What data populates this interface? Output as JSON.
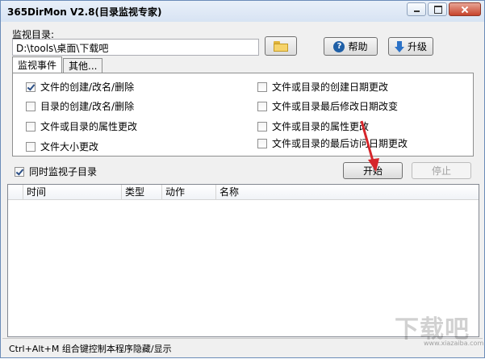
{
  "window": {
    "title": "365DirMon V2.8(目录监视专家)"
  },
  "folder": {
    "label": "监视目录:",
    "path": "D:\\tools\\桌面\\下载吧"
  },
  "buttons": {
    "help": "帮助",
    "upgrade": "升级",
    "start": "开始",
    "stop": "停止"
  },
  "tabs": [
    {
      "label": "监视事件"
    },
    {
      "label": "其他..."
    }
  ],
  "events_left": [
    {
      "label": "文件的创建/改名/删除",
      "checked": true
    },
    {
      "label": "目录的创建/改名/删除",
      "checked": false
    },
    {
      "label": "文件或目录的属性更改",
      "checked": false
    },
    {
      "label": "文件大小更改",
      "checked": false
    }
  ],
  "events_right": [
    {
      "label": "文件或目录的创建日期更改",
      "checked": false
    },
    {
      "label": "文件或目录最后修改日期改变",
      "checked": false
    },
    {
      "label": "文件或目录的属性更改",
      "checked": false
    },
    {
      "label": "文件或目录的最后访问日期更改",
      "checked": false
    }
  ],
  "subdir": {
    "label": "同时监视子目录",
    "checked": true
  },
  "table": {
    "columns": [
      "时间",
      "类型",
      "动作",
      "名称"
    ]
  },
  "status": {
    "text": "Ctrl+Alt+M 组合键控制本程序隐藏/显示"
  },
  "watermark": {
    "text": "下载吧",
    "sub": "www.xiazaiba.com"
  },
  "colors": {
    "arrow": "#d6262b",
    "accent": "#2c72c7"
  }
}
